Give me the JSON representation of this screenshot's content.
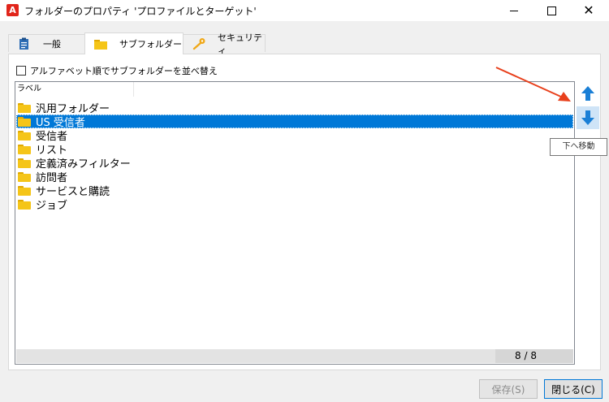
{
  "window": {
    "title": "フォルダーのプロパティ 'プロファイルとターゲット'",
    "app_icon_letter": "A",
    "controls": [
      "minimize",
      "maximize",
      "close"
    ]
  },
  "tabs": [
    {
      "label": "一般",
      "icon": "clipboard-icon",
      "active": false
    },
    {
      "label": "サブフォルダー",
      "icon": "folder-icon",
      "active": true
    },
    {
      "label": "セキュリティ",
      "icon": "key-icon",
      "active": false
    }
  ],
  "sort_option": {
    "label": "アルファベット順でサブフォルダーを並べ替え",
    "checked": false
  },
  "list": {
    "column_header": "ラベル",
    "items": [
      {
        "label": "汎用フォルダー",
        "selected": false
      },
      {
        "label": "US 受信者",
        "selected": true
      },
      {
        "label": "受信者",
        "selected": false
      },
      {
        "label": "リスト",
        "selected": false
      },
      {
        "label": "定義済みフィルター",
        "selected": false
      },
      {
        "label": "訪問者",
        "selected": false
      },
      {
        "label": "サービスと購読",
        "selected": false
      },
      {
        "label": "ジョブ",
        "selected": false
      }
    ],
    "counter": "8 / 8"
  },
  "side_buttons": {
    "tooltip": "下へ移動"
  },
  "buttons": {
    "save": "保存(S)",
    "close": "閉じる(C)"
  },
  "colors": {
    "selection": "#0078d7",
    "arrow_blue": "#1a7fd6",
    "annotation_arrow": "#e8401c",
    "folder": "#f5c518"
  }
}
